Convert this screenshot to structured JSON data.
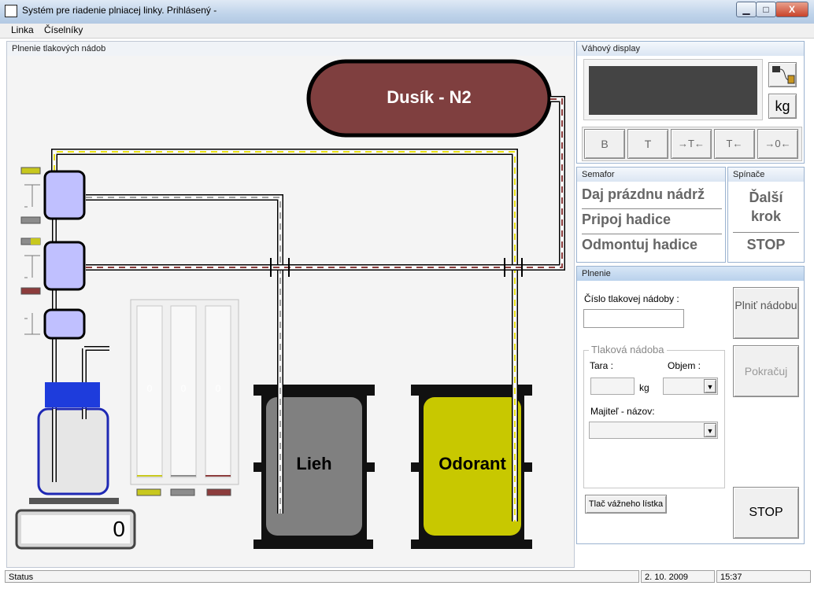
{
  "window": {
    "title": "Systém pre riadenie plniacej linky. Prihlásený -",
    "min_label": "▭",
    "max_label": "□",
    "close_label": "X"
  },
  "menu": [
    "Linka",
    "Číselníky"
  ],
  "main": {
    "title": "Plnenie tlakových nádob",
    "nitrogen_label": "Dusík  -  N2",
    "tank_lieh_label": "Lieh",
    "tank_odorant_label": "Odorant",
    "scale_value": "0",
    "gauges": [
      "0",
      "0",
      "0"
    ],
    "gauge_colors": [
      "#c8c81e",
      "#8c8c8c",
      "#8c3c3c"
    ]
  },
  "scale_panel": {
    "title": "Váhový display",
    "unit": "kg",
    "buttons": [
      "B",
      "T",
      "→T←",
      "T←",
      "→0←"
    ]
  },
  "semafor": {
    "title": "Semafor",
    "items": [
      "Daj prázdnu nádrž",
      "Pripoj hadice",
      "Odmontuj hadice"
    ]
  },
  "spinace": {
    "title": "Spínače",
    "next_label": "Ďalší krok",
    "stop_label": "STOP"
  },
  "plnenie": {
    "title": "Plnenie",
    "cislo_label": "Číslo tlakovej nádoby :",
    "cislo_value": "",
    "group_label": "Tlaková nádoba",
    "tara_label": "Tara :",
    "tara_unit": "kg",
    "objem_label": "Objem :",
    "majitel_label": "Majiteľ - názov:",
    "fill_button": "Plniť nádobu",
    "continue_button": "Pokračuj",
    "print_button": "Tlač vážneho lístka",
    "stop_button": "STOP"
  },
  "status": {
    "text": "Status",
    "date": "2. 10. 2009",
    "time": "15:37"
  },
  "colors": {
    "nitrogen": "#7f3f3f",
    "lieh": "#808080",
    "odorant": "#c8c800",
    "valve": "#c0c0ff",
    "pipe_yellow": "#e8e010",
    "pipe_red": "#8c3c3c",
    "pipe_gray": "#a0a0a0"
  }
}
